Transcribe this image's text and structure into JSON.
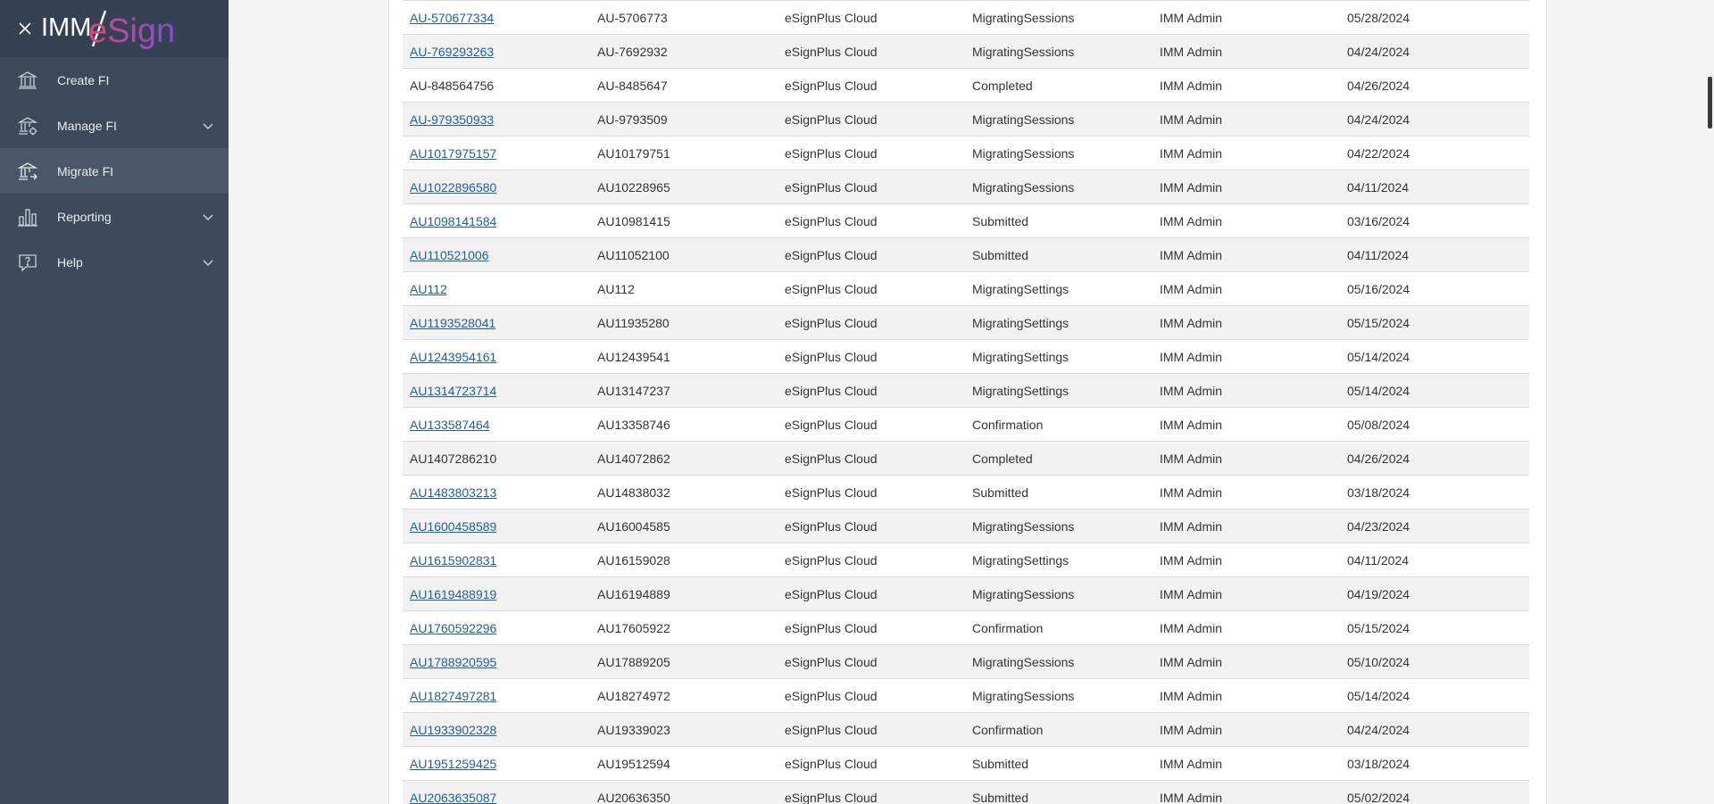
{
  "app": {
    "logo_text_left": "IMM",
    "logo_text_right": "eSign",
    "brand_colors": {
      "sidebar": "#3d4a5c",
      "header": "#354253",
      "active": "#4a5669",
      "link": "#1e5fa0",
      "logo_gradient_start": "#e0457b",
      "logo_gradient_end": "#7b4fd6"
    }
  },
  "sidebar": {
    "items": [
      {
        "label": "Create FI",
        "icon": "bank-icon",
        "has_chevron": false,
        "active": false
      },
      {
        "label": "Manage FI",
        "icon": "bank-settings-icon",
        "has_chevron": true,
        "active": false
      },
      {
        "label": "Migrate FI",
        "icon": "bank-migrate-icon",
        "has_chevron": false,
        "active": true
      },
      {
        "label": "Reporting",
        "icon": "bar-chart-icon",
        "has_chevron": true,
        "active": false
      },
      {
        "label": "Help",
        "icon": "help-bubble-icon",
        "has_chevron": true,
        "active": false
      }
    ]
  },
  "table": {
    "rows": [
      {
        "id": "AU-570677334",
        "linked": true,
        "code": "AU-5706773",
        "platform": "eSignPlus Cloud",
        "status": "MigratingSessions",
        "user": "IMM Admin",
        "date": "05/28/2024"
      },
      {
        "id": "AU-769293263",
        "linked": true,
        "code": "AU-7692932",
        "platform": "eSignPlus Cloud",
        "status": "MigratingSessions",
        "user": "IMM Admin",
        "date": "04/24/2024"
      },
      {
        "id": "AU-848564756",
        "linked": false,
        "code": "AU-8485647",
        "platform": "eSignPlus Cloud",
        "status": "Completed",
        "user": "IMM Admin",
        "date": "04/26/2024"
      },
      {
        "id": "AU-979350933",
        "linked": true,
        "code": "AU-9793509",
        "platform": "eSignPlus Cloud",
        "status": "MigratingSessions",
        "user": "IMM Admin",
        "date": "04/24/2024"
      },
      {
        "id": "AU1017975157",
        "linked": true,
        "code": "AU10179751",
        "platform": "eSignPlus Cloud",
        "status": "MigratingSessions",
        "user": "IMM Admin",
        "date": "04/22/2024"
      },
      {
        "id": "AU1022896580",
        "linked": true,
        "code": "AU10228965",
        "platform": "eSignPlus Cloud",
        "status": "MigratingSessions",
        "user": "IMM Admin",
        "date": "04/11/2024"
      },
      {
        "id": "AU1098141584",
        "linked": true,
        "code": "AU10981415",
        "platform": "eSignPlus Cloud",
        "status": "Submitted",
        "user": "IMM Admin",
        "date": "03/16/2024"
      },
      {
        "id": "AU110521006",
        "linked": true,
        "code": "AU11052100",
        "platform": "eSignPlus Cloud",
        "status": "Submitted",
        "user": "IMM Admin",
        "date": "04/11/2024"
      },
      {
        "id": "AU112",
        "linked": true,
        "code": "AU112",
        "platform": "eSignPlus Cloud",
        "status": "MigratingSettings",
        "user": "IMM Admin",
        "date": "05/16/2024"
      },
      {
        "id": "AU1193528041",
        "linked": true,
        "code": "AU11935280",
        "platform": "eSignPlus Cloud",
        "status": "MigratingSettings",
        "user": "IMM Admin",
        "date": "05/15/2024"
      },
      {
        "id": "AU1243954161",
        "linked": true,
        "code": "AU12439541",
        "platform": "eSignPlus Cloud",
        "status": "MigratingSettings",
        "user": "IMM Admin",
        "date": "05/14/2024"
      },
      {
        "id": "AU1314723714",
        "linked": true,
        "code": "AU13147237",
        "platform": "eSignPlus Cloud",
        "status": "MigratingSettings",
        "user": "IMM Admin",
        "date": "05/14/2024"
      },
      {
        "id": "AU133587464",
        "linked": true,
        "code": "AU13358746",
        "platform": "eSignPlus Cloud",
        "status": "Confirmation",
        "user": "IMM Admin",
        "date": "05/08/2024"
      },
      {
        "id": "AU1407286210",
        "linked": false,
        "code": "AU14072862",
        "platform": "eSignPlus Cloud",
        "status": "Completed",
        "user": "IMM Admin",
        "date": "04/26/2024"
      },
      {
        "id": "AU1483803213",
        "linked": true,
        "code": "AU14838032",
        "platform": "eSignPlus Cloud",
        "status": "Submitted",
        "user": "IMM Admin",
        "date": "03/18/2024"
      },
      {
        "id": "AU1600458589",
        "linked": true,
        "code": "AU16004585",
        "platform": "eSignPlus Cloud",
        "status": "MigratingSessions",
        "user": "IMM Admin",
        "date": "04/23/2024"
      },
      {
        "id": "AU1615902831",
        "linked": true,
        "code": "AU16159028",
        "platform": "eSignPlus Cloud",
        "status": "MigratingSettings",
        "user": "IMM Admin",
        "date": "04/11/2024"
      },
      {
        "id": "AU1619488919",
        "linked": true,
        "code": "AU16194889",
        "platform": "eSignPlus Cloud",
        "status": "MigratingSessions",
        "user": "IMM Admin",
        "date": "04/19/2024"
      },
      {
        "id": "AU1760592296",
        "linked": true,
        "code": "AU17605922",
        "platform": "eSignPlus Cloud",
        "status": "Confirmation",
        "user": "IMM Admin",
        "date": "05/15/2024"
      },
      {
        "id": "AU1788920595",
        "linked": true,
        "code": "AU17889205",
        "platform": "eSignPlus Cloud",
        "status": "MigratingSessions",
        "user": "IMM Admin",
        "date": "05/10/2024"
      },
      {
        "id": "AU1827497281",
        "linked": true,
        "code": "AU18274972",
        "platform": "eSignPlus Cloud",
        "status": "MigratingSessions",
        "user": "IMM Admin",
        "date": "05/14/2024"
      },
      {
        "id": "AU1933902328",
        "linked": true,
        "code": "AU19339023",
        "platform": "eSignPlus Cloud",
        "status": "Confirmation",
        "user": "IMM Admin",
        "date": "04/24/2024"
      },
      {
        "id": "AU1951259425",
        "linked": true,
        "code": "AU19512594",
        "platform": "eSignPlus Cloud",
        "status": "Submitted",
        "user": "IMM Admin",
        "date": "03/18/2024"
      },
      {
        "id": "AU2063635087",
        "linked": true,
        "code": "AU20636350",
        "platform": "eSignPlus Cloud",
        "status": "Submitted",
        "user": "IMM Admin",
        "date": "05/02/2024"
      }
    ]
  }
}
